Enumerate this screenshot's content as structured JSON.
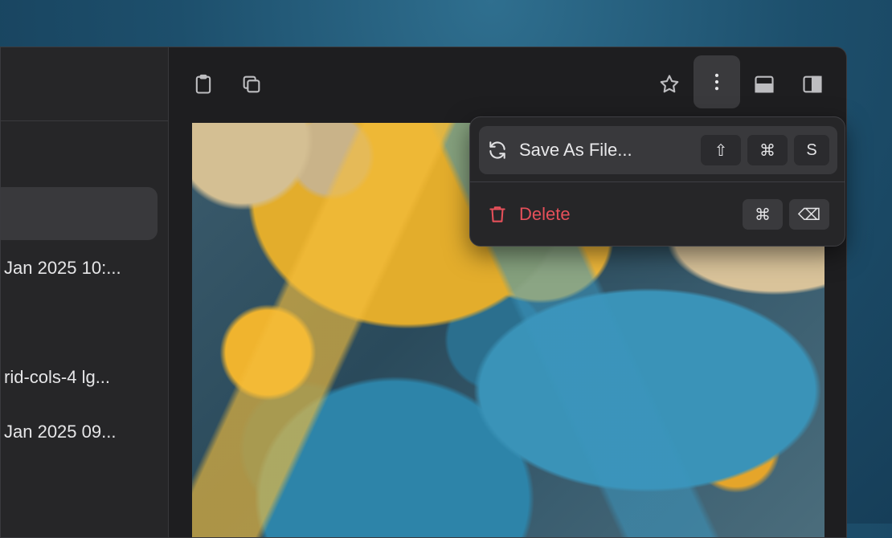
{
  "sidebar": {
    "rows": [
      {
        "text": "Jan 2025 10:..."
      },
      {
        "text": "rid-cols-4 lg..."
      },
      {
        "text": "Jan 2025 09..."
      }
    ]
  },
  "toolbar": {
    "icons": [
      "clipboard-icon",
      "copy-icon",
      "star-icon",
      "more-vertical-icon",
      "panel-bottom-icon",
      "panel-right-icon"
    ]
  },
  "menu": {
    "save": {
      "label": "Save As File...",
      "keys": [
        "⇧",
        "⌘",
        "S"
      ]
    },
    "delete": {
      "label": "Delete",
      "keys": [
        "⌘",
        "⌫"
      ]
    }
  },
  "colors": {
    "danger": "#e6505a",
    "menu_bg": "#262628",
    "window_bg": "#1e1e20"
  }
}
